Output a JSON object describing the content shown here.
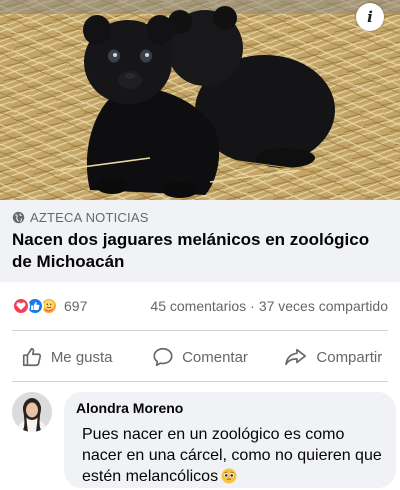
{
  "post": {
    "image_alt": "Dos crías de jaguar negro sobre paja",
    "info_icon": "info-icon",
    "info_label": "i"
  },
  "link_preview": {
    "source": "AZTECA NOTICIAS",
    "source_icon": "globe-icon",
    "title": "Nacen dos jaguares melánicos en zoológico de Michoacán"
  },
  "stats": {
    "reactions": [
      "love",
      "like",
      "care"
    ],
    "reaction_count": "697",
    "comments": "45 comentarios",
    "separator": "·",
    "shares": "37 veces compartido"
  },
  "actions": {
    "like_label": "Me gusta",
    "comment_label": "Comentar",
    "share_label": "Compartir"
  },
  "comment": {
    "author": "Alondra Moreno",
    "text": "Pues nacer en un zoológico es como nacer en una cárcel, como no quieren que estén melancólicos",
    "emoji": "pleading-face-emoji"
  },
  "colors": {
    "link_bg": "#f0f2f5",
    "secondary_text": "#65676b",
    "like_blue": "#1877f2",
    "love_red": "#f33e58",
    "care_yellow": "#f7b125"
  }
}
